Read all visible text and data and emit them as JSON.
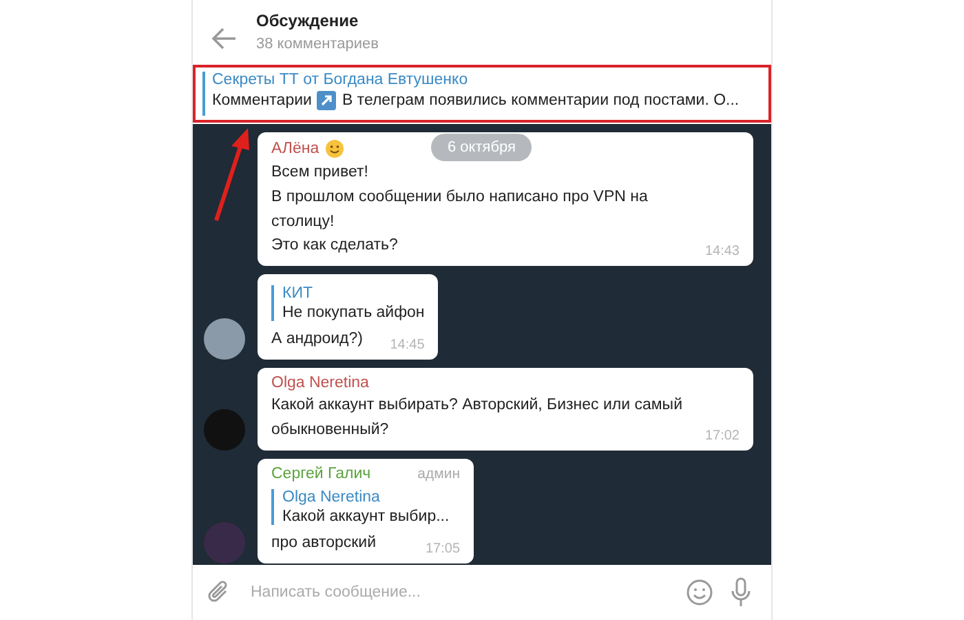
{
  "header": {
    "title": "Обсуждение",
    "subtitle": "38 комментариев"
  },
  "pinned": {
    "title": "Секреты ТТ от Богдана Евтушенко",
    "label": "Комментарии",
    "text": "В телеграм появились комментарии под постами. О...",
    "highlighted": true
  },
  "date": "6 октября",
  "messages": [
    {
      "author": "АЛёна",
      "color": "#c0504d",
      "emoji": true,
      "avatar": false,
      "text": "Всем привет!\nВ прошлом сообщении было написано про VPN на столицу!\nЭто  как сделать?",
      "time": "14:43"
    },
    {
      "avatar": true,
      "reply": {
        "author": "КИТ",
        "text": "Не покупать айфон"
      },
      "text": "А андроид?)",
      "time": "14:45"
    },
    {
      "author": "Olga Neretina",
      "color": "#c0504d",
      "avatar": true,
      "text": "Какой аккаунт выбирать? Авторский, Бизнес или самый обыкновенный?",
      "time": "17:02"
    },
    {
      "author": "Сергей Галич",
      "color": "#5aa33d",
      "badge": "админ",
      "avatar": true,
      "reply": {
        "author": "Olga Neretina",
        "text": "Какой аккаунт выбир..."
      },
      "text": "про авторский",
      "time": "17:05"
    }
  ],
  "input": {
    "placeholder": "Написать сообщение..."
  }
}
